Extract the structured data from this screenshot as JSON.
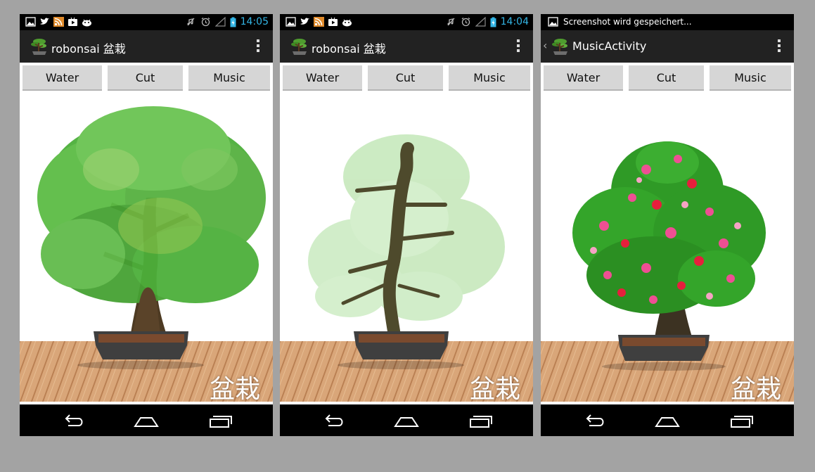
{
  "colors": {
    "accent_clock": "#33b5e5",
    "action_bar": "#222222",
    "button_bg": "#d6d6d6",
    "leaf_green": "#4caf3a",
    "blossom_pink": "#ee4f93",
    "blossom_red": "#e61f3c"
  },
  "phones": [
    {
      "status": {
        "clock": "14:05",
        "notification": ""
      },
      "app_title": "robonsai 盆栽",
      "show_up_indicator": false,
      "buttons": {
        "water": "Water",
        "cut": "Cut",
        "music": "Music"
      },
      "scene": {
        "state": "full foliage",
        "kanji": "盆栽"
      }
    },
    {
      "status": {
        "clock": "14:04",
        "notification": ""
      },
      "app_title": "robonsai 盆栽",
      "show_up_indicator": false,
      "buttons": {
        "water": "Water",
        "cut": "Cut",
        "music": "Music"
      },
      "scene": {
        "state": "pruned branches",
        "kanji": "盆栽"
      }
    },
    {
      "status": {
        "clock": "",
        "notification": "Screenshot wird gespeichert..."
      },
      "app_title": "MusicActivity",
      "show_up_indicator": true,
      "buttons": {
        "water": "Water",
        "cut": "Cut",
        "music": "Music"
      },
      "scene": {
        "state": "blossoming",
        "kanji": "盆栽"
      }
    }
  ],
  "icons": {
    "status_left": [
      "gallery-icon",
      "twitter-icon",
      "rss-icon",
      "play-store-icon",
      "android-icon"
    ],
    "status_right": [
      "mute-icon",
      "alarm-icon",
      "signal-icon",
      "battery-icon"
    ],
    "nav": [
      "back-icon",
      "home-icon",
      "recents-icon"
    ]
  }
}
